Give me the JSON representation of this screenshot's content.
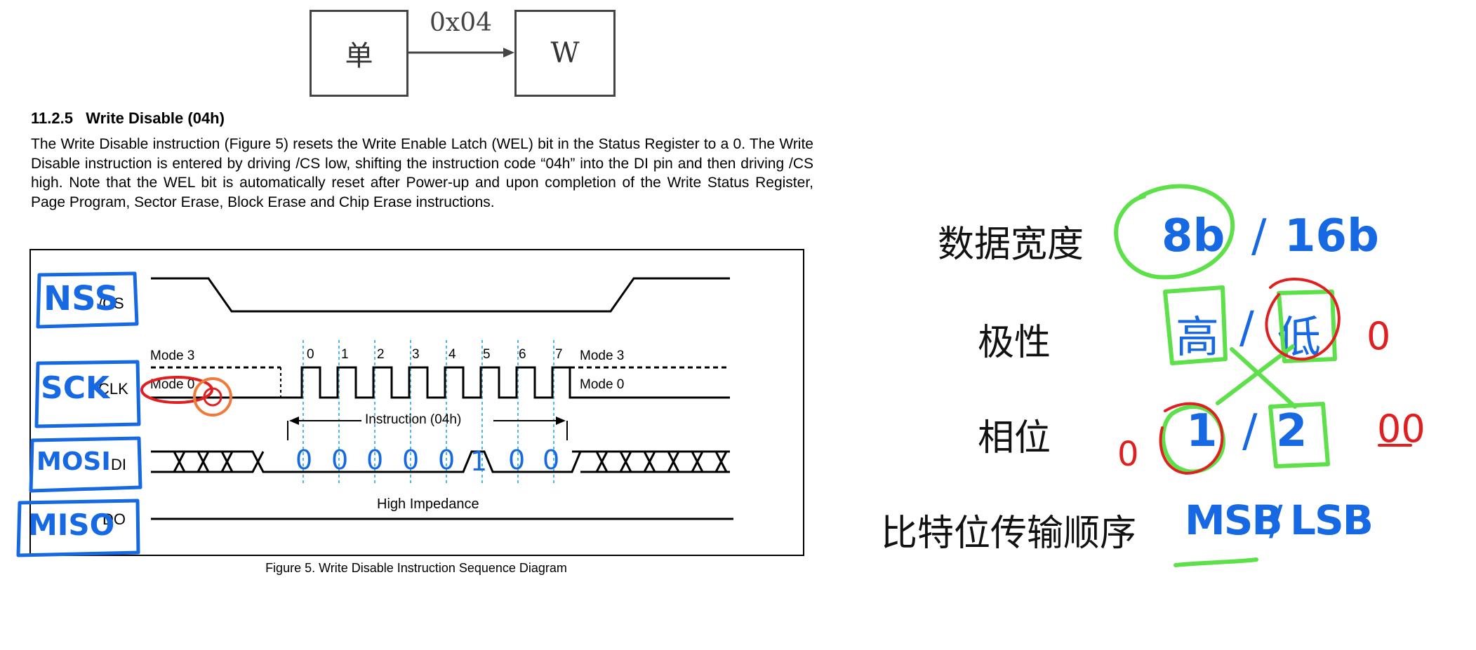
{
  "flow": {
    "source_label": "单",
    "target_label": "W",
    "arrow_label": "0x04"
  },
  "document": {
    "section_number": "11.2.5",
    "section_title": "Write Disable (04h)",
    "body": "The Write Disable instruction (Figure 5) resets the Write Enable Latch (WEL) bit in the Status Register to a 0. The Write Disable instruction is entered by driving /CS low, shifting the instruction code “04h” into the DI pin and then driving /CS high. Note that the WEL bit is automatically reset after Power-up and upon completion of the Write Status Register, Page Program, Sector Erase, Block Erase and Chip Erase instructions.",
    "figure_caption": "Figure 5. Write Disable Instruction Sequence Diagram"
  },
  "timing": {
    "signals": {
      "cs": "/CS",
      "clk": "CLK",
      "di": "DI",
      "do": "DO"
    },
    "mode3_left": "Mode 3",
    "mode0_left": "Mode 0",
    "mode3_right": "Mode 3",
    "mode0_right": "Mode 0",
    "clock_numbers": [
      "0",
      "1",
      "2",
      "3",
      "4",
      "5",
      "6",
      "7"
    ],
    "instruction_label": "Instruction (04h)",
    "high_impedance": "High Impedance",
    "handwritten_bits": [
      "0",
      "0",
      "0",
      "0",
      "0",
      "1",
      "0",
      "0"
    ]
  },
  "handwritten_labels": {
    "nss": "NSS",
    "sck": "SCK",
    "mosi": "MOSI",
    "miso": "MISO"
  },
  "notes": {
    "rows": [
      {
        "label": "数据宽度",
        "options": [
          "8b",
          "/",
          "16b"
        ]
      },
      {
        "label": "极性",
        "options": [
          "高",
          "/",
          "低"
        ]
      },
      {
        "label": "相位",
        "options": [
          "1",
          "/",
          "2"
        ]
      },
      {
        "label": "比特位传输顺序",
        "options": [
          "MSB",
          "/",
          "LSB"
        ]
      }
    ],
    "side_marks": [
      "0",
      "0",
      "00"
    ]
  },
  "colors": {
    "blue_ink": "#1668e3",
    "green_ink": "#5ee04a",
    "red_ink": "#e02020",
    "orange_ink": "#f07a3a",
    "dotted_line": "#4ab8e8"
  }
}
